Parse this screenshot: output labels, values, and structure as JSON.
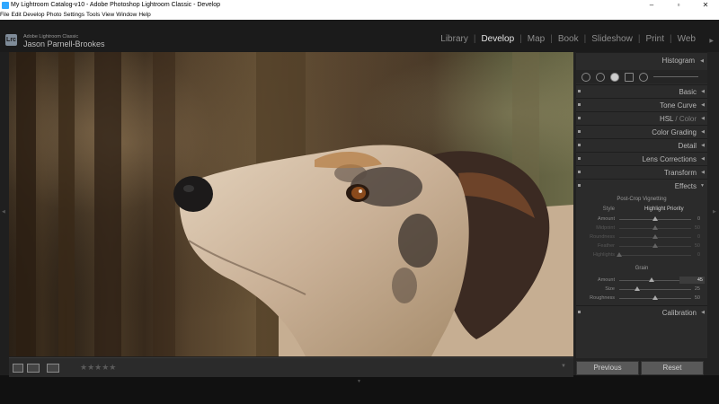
{
  "window": {
    "title": "My Lightroom Catalog-v10 - Adobe Photoshop Lightroom Classic - Develop",
    "controls": [
      "–",
      "▫",
      "✕"
    ]
  },
  "menu": [
    "File",
    "Edit",
    "Develop",
    "Photo",
    "Settings",
    "Tools",
    "View",
    "Window",
    "Help"
  ],
  "identity": {
    "logo": "Lrc",
    "app_name": "Adobe Lightroom Classic",
    "user": "Jason Parnell-Brookes"
  },
  "modules": [
    "Library",
    "Develop",
    "Map",
    "Book",
    "Slideshow",
    "Print",
    "Web"
  ],
  "active_module": "Develop",
  "panels": {
    "histogram": "Histogram",
    "basic": "Basic",
    "tone_curve": "Tone Curve",
    "hsl": "HSL",
    "hsl_sep": " / ",
    "color": "Color",
    "color_grading": "Color Grading",
    "detail": "Detail",
    "lens": "Lens Corrections",
    "transform": "Transform",
    "effects": "Effects",
    "calibration": "Calibration"
  },
  "effects": {
    "vignette_title": "Post-Crop Vignetting",
    "style_label": "Style",
    "style_value": "Highlight Priority",
    "vignette_sliders": [
      {
        "label": "Amount",
        "value": "0",
        "pos": 0.5
      },
      {
        "label": "Midpoint",
        "value": "50",
        "pos": 0.5
      },
      {
        "label": "Roundness",
        "value": "0",
        "pos": 0.5
      },
      {
        "label": "Feather",
        "value": "50",
        "pos": 0.5
      },
      {
        "label": "Highlights",
        "value": "0",
        "pos": 0.0
      }
    ],
    "grain_title": "Grain",
    "grain_sliders": [
      {
        "label": "Amount",
        "value": "45",
        "pos": 0.45,
        "boxed": true
      },
      {
        "label": "Size",
        "value": "25",
        "pos": 0.25
      },
      {
        "label": "Roughness",
        "value": "50",
        "pos": 0.5
      }
    ]
  },
  "buttons": {
    "previous": "Previous",
    "reset": "Reset"
  },
  "toolbar": {
    "rating": "★★★★★"
  },
  "colors": {
    "accent_active": "#e6e6e6",
    "panel_bg": "#2b2b2b"
  }
}
